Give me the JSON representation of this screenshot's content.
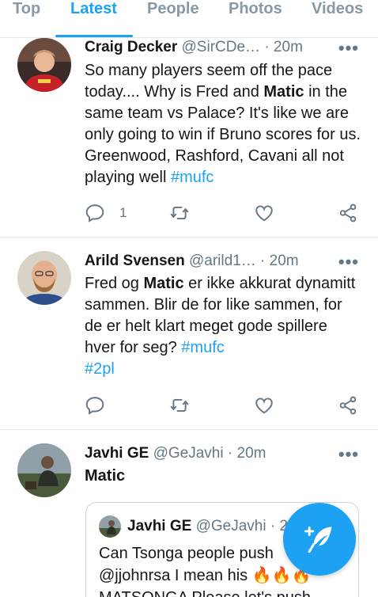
{
  "tabs": [
    {
      "label": "Top",
      "active": false
    },
    {
      "label": "Latest",
      "active": true
    },
    {
      "label": "People",
      "active": false
    },
    {
      "label": "Photos",
      "active": false
    },
    {
      "label": "Videos",
      "active": false
    }
  ],
  "tweets": [
    {
      "name": "Craig Decker",
      "handle": "@SirCDe…",
      "time": "· 20m",
      "text_parts": [
        "So many players seem off the pace today.... Why is Fred and ",
        "Matic",
        " in the same team vs Palace? It's like we are only going to win if Bruno scores for us. Greenwood, Rashford, Cavani all not playing well ",
        "#mufc"
      ],
      "reply_count": "1",
      "avatar_icon": "avatar-red-shirt"
    },
    {
      "name": "Arild Svensen",
      "handle": "@arild1…",
      "time": "· 20m",
      "text_parts": [
        "Fred og ",
        "Matic",
        " er ikke akkurat dynamitt sammen. Blir de for like sammen, for de er helt klart meget gode spillere hver for seg? ",
        "#mufc",
        "#2pl"
      ],
      "reply_count": "",
      "avatar_icon": "avatar-bald-man"
    },
    {
      "name": "Javhi GE",
      "handle": "@GeJavhi",
      "time": "· 20m",
      "text_parts": [
        "Matic"
      ],
      "avatar_icon": "avatar-outdoor"
    }
  ],
  "quote": {
    "name": "Javhi GE",
    "handle": "@GeJavhi",
    "time": "· 2",
    "line1": "Can Tsonga people push",
    "line2_prefix": "@jjohnrsa I mean his ",
    "emoji": "🔥🔥🔥",
    "line3": "MATSONGA Please let's push"
  },
  "icons": {
    "more": "more-dots-icon",
    "reply": "reply-icon",
    "retweet": "retweet-icon",
    "like": "heart-icon",
    "share": "share-icon",
    "compose": "compose-tweet-icon"
  },
  "colors": {
    "accent": "#1da1f2",
    "muted": "#657786",
    "text": "#14171a"
  }
}
